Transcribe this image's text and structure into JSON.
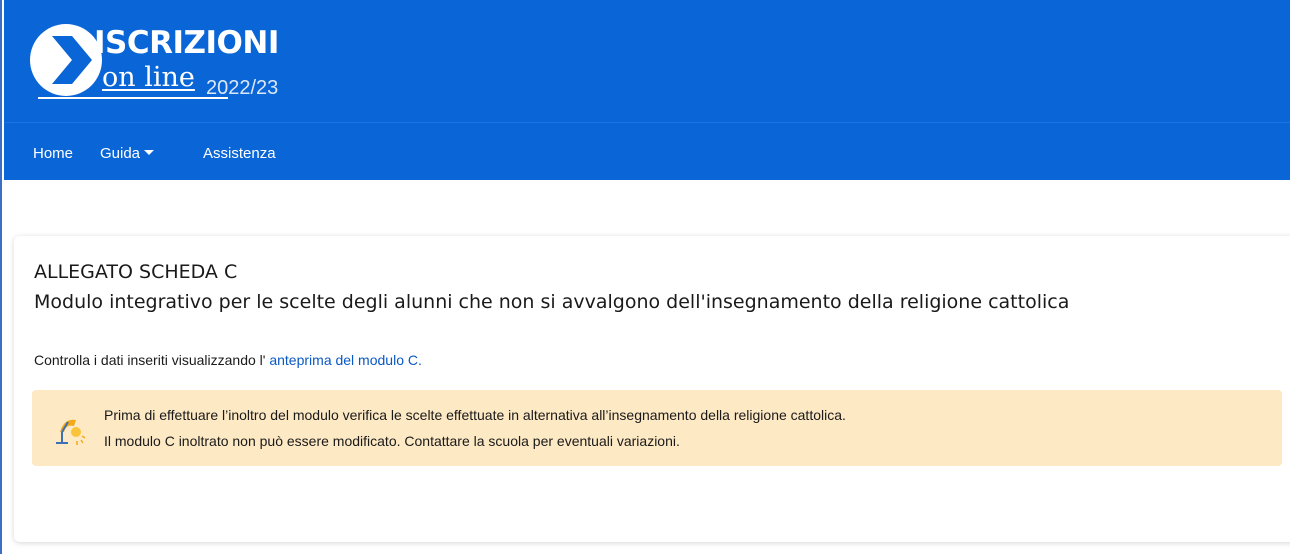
{
  "header": {
    "logo": {
      "title": "ISCRIZIONI",
      "subtitle": "on line",
      "year": "2022/23"
    },
    "nav": [
      {
        "label": "Home"
      },
      {
        "label": "Guida",
        "has_dropdown": true
      },
      {
        "label": "Assistenza"
      }
    ]
  },
  "card": {
    "title_line1": "ALLEGATO SCHEDA C",
    "title_line2": "Modulo integrativo per le scelte degli alunni che non si avvalgono dell'insegnamento della religione cattolica",
    "intro_text": "Controlla i dati inseriti visualizzando l'",
    "intro_link": "anteprima del modulo C.",
    "alert": {
      "icon": "desk-lamp-icon",
      "line1": "Prima di effettuare l’inoltro del modulo verifica le scelte effettuate in alternativa all’insegnamento della religione cattolica.",
      "line2": "Il modulo C inoltrato non può essere modificato. Contattare la scuola per eventuali variazioni."
    }
  },
  "colors": {
    "header_blue": "#0a66d6",
    "link_blue": "#0a58c4",
    "alert_background": "#fde9c4"
  }
}
